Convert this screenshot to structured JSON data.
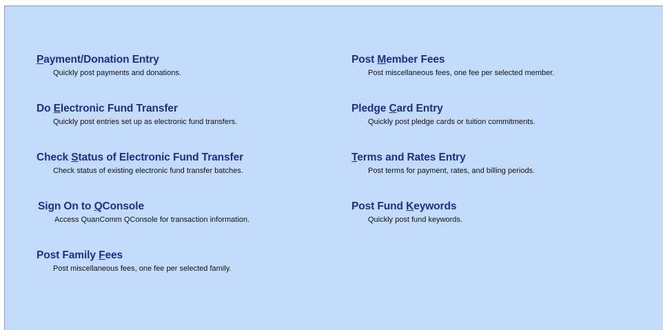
{
  "entries": [
    {
      "pre": "",
      "key": "P",
      "post": "ayment/Donation Entry",
      "desc": "Quickly post payments and donations."
    },
    {
      "pre": "Do ",
      "key": "E",
      "post": "lectronic Fund Transfer",
      "desc": "Quickly post entries set up as electronic fund transfers."
    },
    {
      "pre": "Check ",
      "key": "S",
      "post": "tatus of Electronic Fund Transfer",
      "desc": "Check status of existing electronic fund transfer batches."
    },
    {
      "pre": "Sign On to ",
      "key": "Q",
      "post": "Console",
      "desc": "Access QuanComm QConsole for transaction information."
    },
    {
      "pre": "Post Family ",
      "key": "F",
      "post": "ees",
      "desc": "Post miscellaneous fees, one fee per selected family."
    },
    {
      "pre": "Post ",
      "key": "M",
      "post": "ember Fees",
      "desc": "Post miscellaneous fees, one fee per selected member."
    },
    {
      "pre": "Pledge ",
      "key": "C",
      "post": "ard Entry",
      "desc": "Quickly post pledge cards or tuition commitments."
    },
    {
      "pre": "",
      "key": "T",
      "post": "erms and Rates Entry",
      "desc": "Post terms for payment, rates, and billing periods."
    },
    {
      "pre": "Post Fund ",
      "key": "K",
      "post": "eywords",
      "desc": "Quickly post fund keywords."
    }
  ]
}
